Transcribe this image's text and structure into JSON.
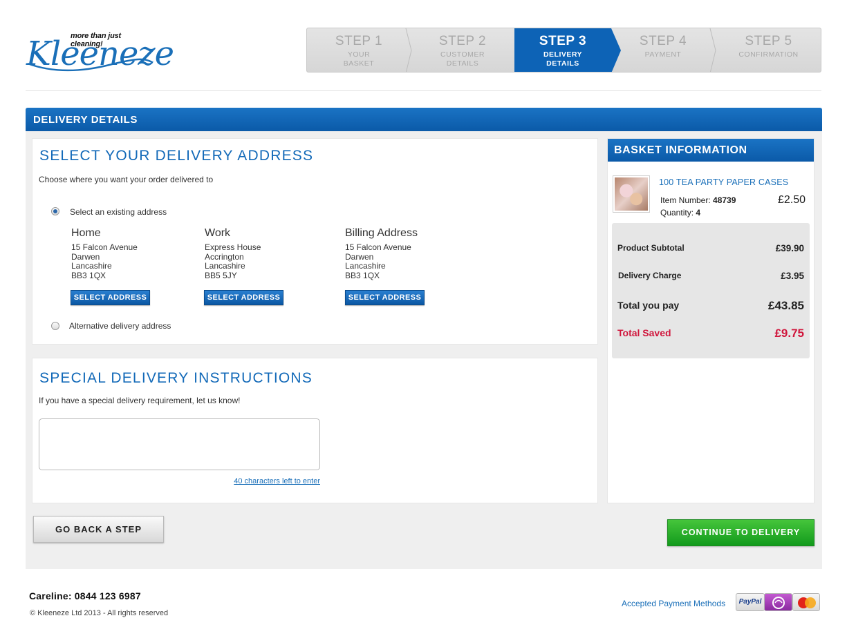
{
  "header": {
    "brand": "Kleeneze",
    "tagline": "more than just cleaning!",
    "steps": [
      {
        "num": "STEP 1",
        "label_line1": "YOUR",
        "label_line2": "BASKET",
        "active": false
      },
      {
        "num": "STEP 2",
        "label_line1": "CUSTOMER",
        "label_line2": "DETAILS",
        "active": false
      },
      {
        "num": "STEP 3",
        "label_line1": "DELIVERY",
        "label_line2": "DETAILS",
        "active": true
      },
      {
        "num": "STEP 4",
        "label_line1": "PAYMENT",
        "label_line2": "",
        "active": false
      },
      {
        "num": "STEP 5",
        "label_line1": "CONFIRMATION",
        "label_line2": "",
        "active": false
      }
    ]
  },
  "main": {
    "title": "DELIVERY DETAILS",
    "address_section": {
      "heading": "SELECT YOUR DELIVERY ADDRESS",
      "subtitle": "Choose where you want your order delivered to",
      "existing_label": "Select an existing address",
      "existing_selected": true,
      "alternative_label": "Alternative delivery address",
      "alternative_selected": false,
      "addresses": [
        {
          "name": "Home",
          "line1": "15 Falcon Avenue",
          "line2": "Darwen",
          "line3": "Lancashire",
          "line4": "BB3 1QX",
          "button": "SELECT ADDRESS"
        },
        {
          "name": "Work",
          "line1": "Express House",
          "line2": "Accrington",
          "line3": "Lancashire",
          "line4": "BB5 5JY",
          "button": "SELECT ADDRESS"
        },
        {
          "name": "Billing Address",
          "line1": "15 Falcon Avenue",
          "line2": "Darwen",
          "line3": "Lancashire",
          "line4": "BB3 1QX",
          "button": "SELECT ADDRESS"
        }
      ]
    },
    "instructions_section": {
      "heading": "SPECIAL DELIVERY INSTRUCTIONS",
      "subtitle": "If you have a special delivery requirement, let us know!",
      "value": "",
      "chars_left": "40 characters left to enter"
    },
    "back_button": "GO BACK A STEP",
    "continue_button": "CONTINUE TO DELIVERY"
  },
  "basket": {
    "title": "BASKET INFORMATION",
    "item": {
      "name": "100 TEA PARTY PAPER CASES",
      "item_number_label": "Item Number:",
      "item_number": "48739",
      "quantity_label": "Quantity:",
      "quantity": "4",
      "price": "£2.50"
    },
    "totals": {
      "subtotal_label": "Product Subtotal",
      "subtotal": "£39.90",
      "delivery_label": "Delivery Charge",
      "delivery": "£3.95",
      "total_label": "Total you pay",
      "total": "£43.85",
      "saved_label": "Total Saved",
      "saved": "£9.75"
    }
  },
  "footer": {
    "careline": "Careline: 0844 123 6987",
    "copyright": "© Kleeneze Ltd 2013 - All rights reserved",
    "accepted_label": "Accepted Payment Methods",
    "paypal": "PayPal",
    "payment_icons": [
      "paypal-icon",
      "maestro-icon",
      "mastercard-icon"
    ]
  },
  "colors": {
    "primary_blue": "#0d63b6",
    "heading_blue": "#1269b8",
    "continue_green": "#129a1c",
    "saved_red": "#d0163c"
  }
}
